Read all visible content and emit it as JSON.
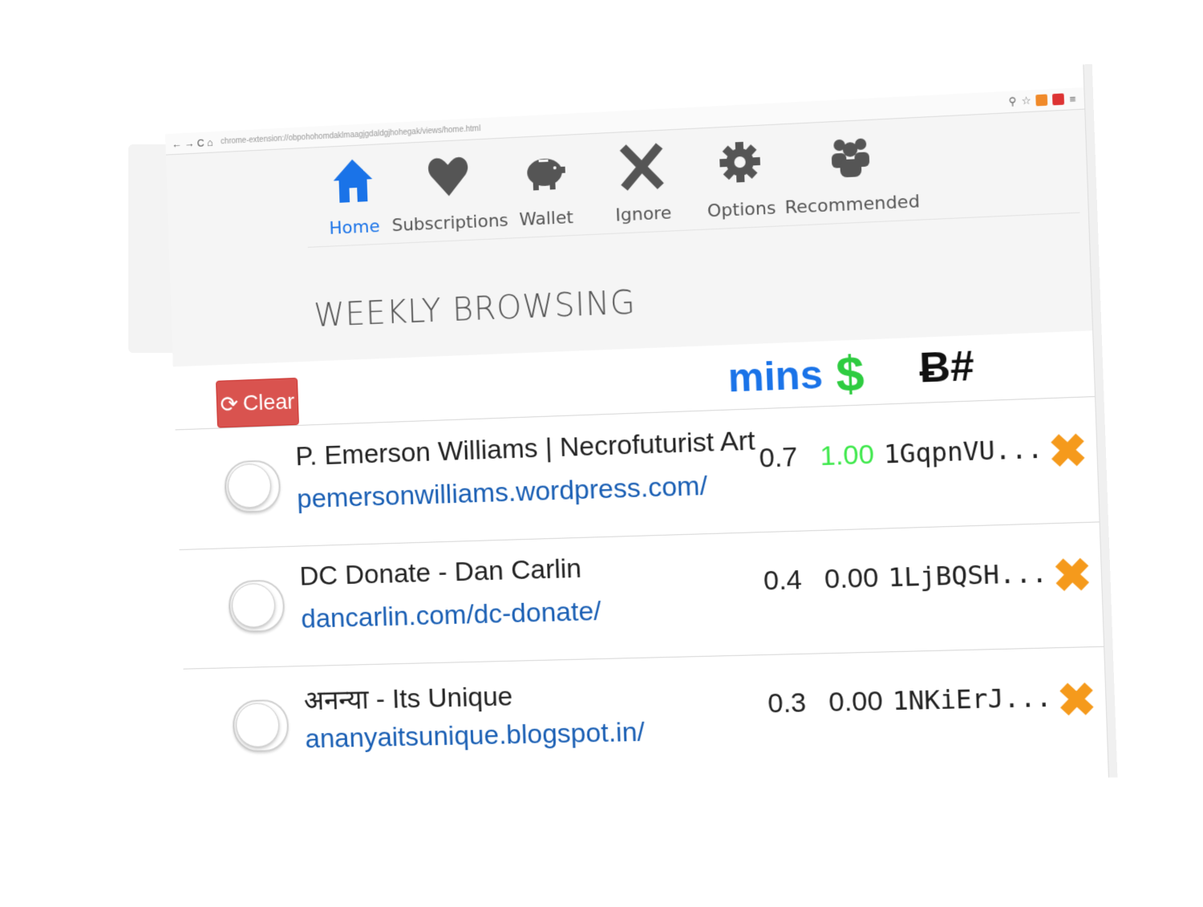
{
  "browser": {
    "url": "chrome-extension://obpohohomdaklmaagjgdaldgjhohegak/views/home.html",
    "nav_glyphs": "← → C ⌂"
  },
  "nav": {
    "items": [
      {
        "label": "Home",
        "icon": "home-icon",
        "active": true
      },
      {
        "label": "Subscriptions",
        "icon": "heart-icon"
      },
      {
        "label": "Wallet",
        "icon": "piggy-bank-icon"
      },
      {
        "label": "Ignore",
        "icon": "x-icon"
      },
      {
        "label": "Options",
        "icon": "gear-icon"
      },
      {
        "label": "Recommended",
        "icon": "users-icon"
      }
    ]
  },
  "section_title": "WEEKLY BROWSING",
  "toolbar": {
    "clear_label": "Clear",
    "col_mins": "mins",
    "col_dollar": "$",
    "col_btc": "Ƀ#"
  },
  "rows": [
    {
      "title": "P. Emerson Williams | Necrofuturist Art",
      "url": "pemersonwilliams.wordpress.com/",
      "mins": "0.7",
      "dollars": "1.00",
      "address": "1GqpnVU...",
      "highlight": true
    },
    {
      "title": "DC Donate - Dan Carlin",
      "url": "dancarlin.com/dc-donate/",
      "mins": "0.4",
      "dollars": "0.00",
      "address": "1LjBQSH...",
      "highlight": false
    },
    {
      "title": "अनन्या - Its Unique",
      "url": "ananyaitsunique.blogspot.in/",
      "mins": "0.3",
      "dollars": "0.00",
      "address": "1NKiErJ...",
      "highlight": false
    }
  ],
  "colors": {
    "accent": "#1a73e8",
    "clear": "#d9534f",
    "green": "#2ecc40",
    "remove": "#f59a1c"
  }
}
